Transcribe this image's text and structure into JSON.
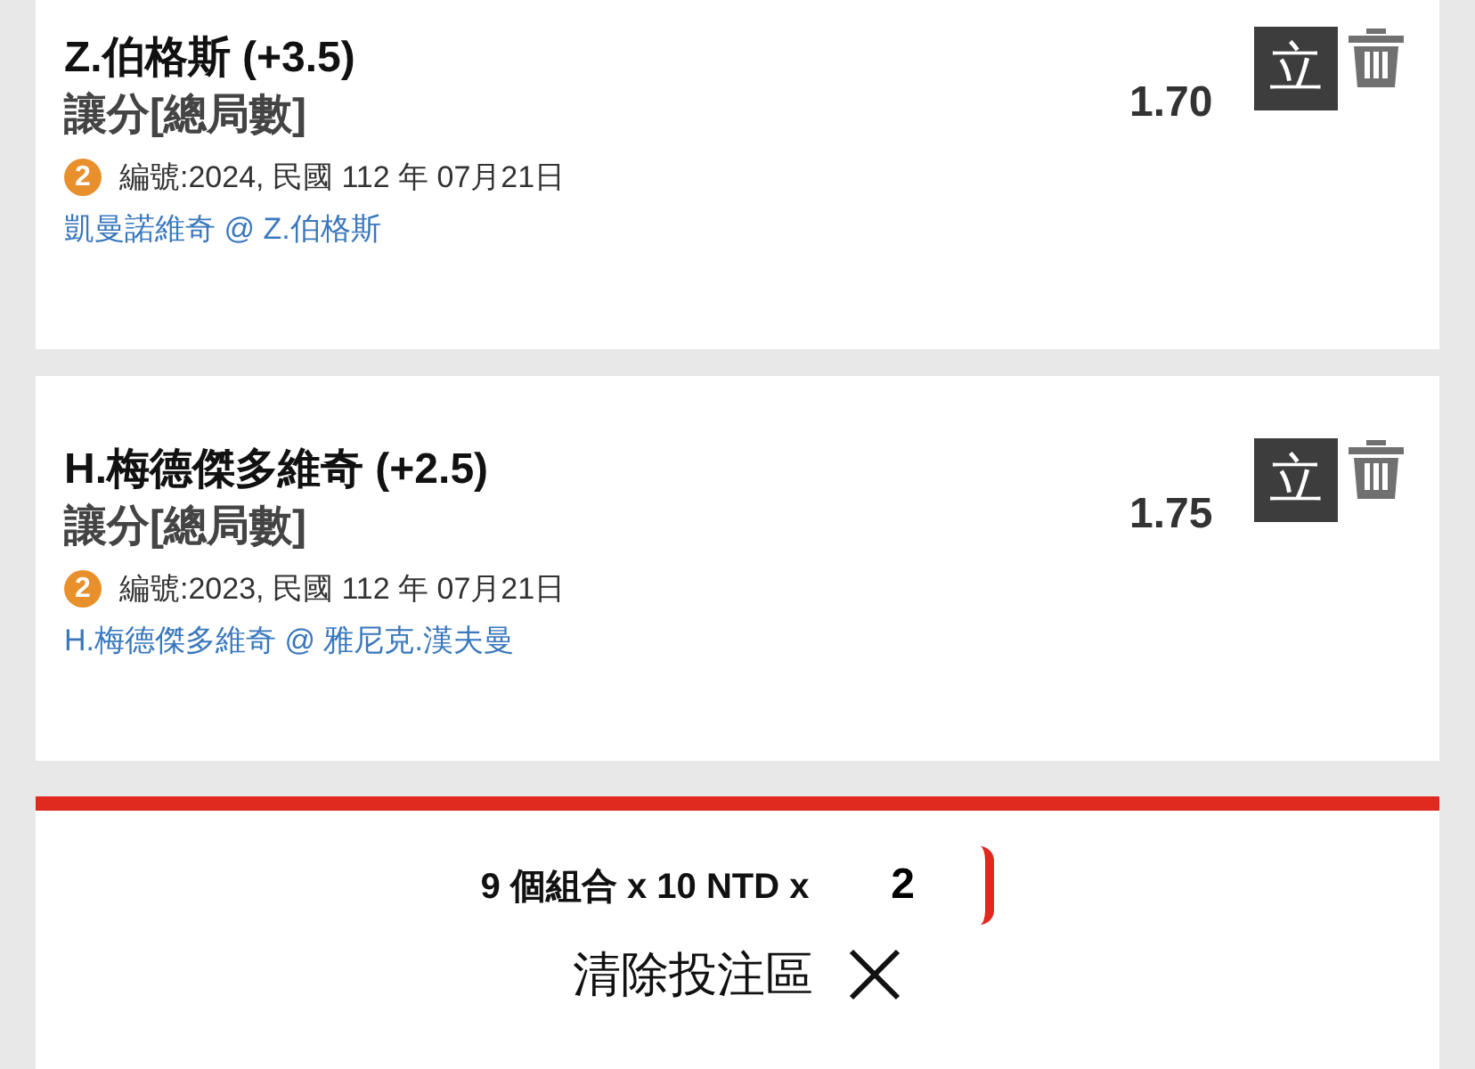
{
  "bets": [
    {
      "title": "Z.伯格斯 (+3.5)",
      "market": "讓分[總局數]",
      "odds": "1.70",
      "badge": "2",
      "info": "編號:2024, 民國 112 年 07月21日",
      "match": "凱曼諾維奇 @ Z.伯格斯",
      "stand_button": "立"
    },
    {
      "title": "H.梅德傑多維奇 (+2.5)",
      "market": "讓分[總局數]",
      "odds": "1.75",
      "badge": "2",
      "info": "編號:2023, 民國 112 年 07月21日",
      "match": "H.梅德傑多維奇 @ 雅尼克.漢夫曼",
      "stand_button": "立"
    }
  ],
  "summary": {
    "text": "9 個組合 x 10 NTD x",
    "multiplier": "2",
    "clear_label": "清除投注區"
  }
}
